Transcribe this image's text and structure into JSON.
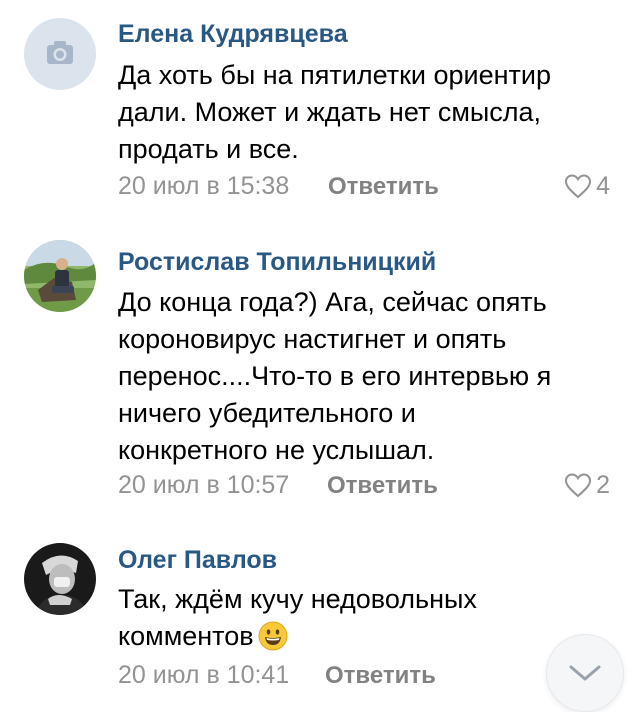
{
  "comments": [
    {
      "author": "Елена Кудрявцева",
      "avatar_icon": "camera-placeholder-icon",
      "lines": [
        "Да хоть бы на пятилетки ориентир",
        "дали. Может и ждать нет смысла,",
        "продать и все."
      ],
      "date": "20 июл в 15:38",
      "reply_label": "Ответить",
      "likes": "4"
    },
    {
      "author": "Ростислав Топильницкий",
      "lines": [
        "До конца года?) Ага, сейчас опять",
        "короновирус настигнет и опять",
        "перенос....Что-то в его интервью я",
        "ничего убедительного и",
        "конкретного не услышал."
      ],
      "date": "20 июл в 10:57",
      "reply_label": "Ответить",
      "likes": "2"
    },
    {
      "author": "Олег Павлов",
      "lines": [
        "Так, ждём кучу недовольных",
        "комментов"
      ],
      "emoji": "grinning-face-emoji",
      "date": "20 июл в 10:41",
      "reply_label": "Ответить"
    }
  ],
  "scroll_down_icon": "chevron-down-icon",
  "colors": {
    "author": "#2a5885",
    "meta": "#939393",
    "reply": "#828282",
    "avatar_placeholder": "#dbe3ec"
  }
}
